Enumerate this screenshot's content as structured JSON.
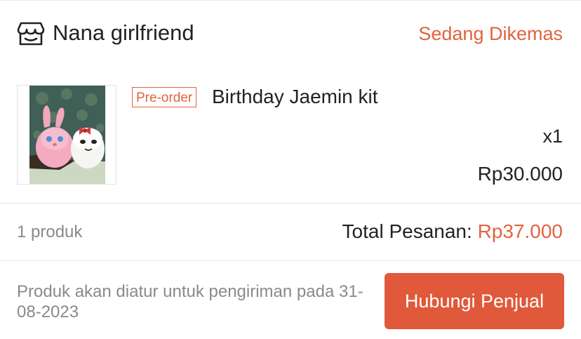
{
  "shop": {
    "name": "Nana girlfriend",
    "icon": "shop-icon"
  },
  "order": {
    "status": "Sedang Dikemas"
  },
  "product": {
    "badge": "Pre-order",
    "name": "Birthday Jaemin kit",
    "quantity": "x1",
    "price": "Rp30.000",
    "image": "plush-toys-photo"
  },
  "summary": {
    "product_count": "1 produk",
    "total_label": "Total Pesanan: ",
    "total_value": "Rp37.000"
  },
  "footer": {
    "shipping_info": "Produk akan diatur untuk pengiriman pada 31-08-2023",
    "contact_button": "Hubungi Penjual"
  },
  "colors": {
    "accent": "#e0633f",
    "button": "#e0593a",
    "muted": "#8a8a8a"
  }
}
